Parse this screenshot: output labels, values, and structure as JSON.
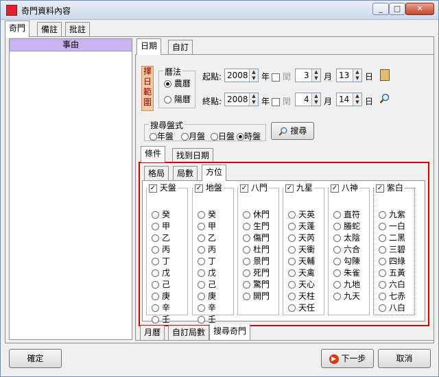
{
  "window": {
    "title": "奇門資料內容",
    "min": "_",
    "max": "□",
    "close": "✕"
  },
  "outer_tabs": [
    "奇門",
    "備註",
    "批註"
  ],
  "left_panel": {
    "header": "事由"
  },
  "date_tabs": [
    "日期",
    "自訂"
  ],
  "range": {
    "label": [
      "擇",
      "日",
      "範",
      "圍"
    ],
    "calendar_title": "曆法",
    "calendar_options": [
      "農曆",
      "陽曆"
    ],
    "start_label": "起點:",
    "end_label": "終點:",
    "start": {
      "year": "2008",
      "year_unit": "年",
      "leap": "閏",
      "month": "3",
      "month_unit": "月",
      "day": "13",
      "day_unit": "日"
    },
    "end": {
      "year": "2008",
      "year_unit": "年",
      "leap": "閏",
      "month": "4",
      "month_unit": "月",
      "day": "14",
      "day_unit": "日"
    }
  },
  "search_mode": {
    "title": "搜尋盤式",
    "options": [
      "年盤",
      "月盤",
      "日盤",
      "時盤"
    ],
    "search_button": "搜尋"
  },
  "result_tabs": [
    "條件",
    "找到日期"
  ],
  "inner_tabs": [
    "格局",
    "局數",
    "方位"
  ],
  "columns": [
    {
      "title": "天盤",
      "items": [
        "癸",
        "甲",
        "乙",
        "丙",
        "丁",
        "戊",
        "己",
        "庚",
        "辛",
        "壬"
      ]
    },
    {
      "title": "地盤",
      "items": [
        "癸",
        "甲",
        "乙",
        "丙",
        "丁",
        "戊",
        "己",
        "庚",
        "辛",
        "壬"
      ]
    },
    {
      "title": "八門",
      "items": [
        "休門",
        "生門",
        "傷門",
        "杜門",
        "景門",
        "死門",
        "驚門",
        "開門"
      ]
    },
    {
      "title": "九星",
      "items": [
        "天英",
        "天蓬",
        "天芮",
        "天衝",
        "天輔",
        "天禽",
        "天心",
        "天柱",
        "天任"
      ]
    },
    {
      "title": "八神",
      "items": [
        "直符",
        "螣蛇",
        "太陰",
        "六合",
        "勾陳",
        "朱雀",
        "九地",
        "九天"
      ]
    },
    {
      "title": "紫白",
      "items": [
        "九紫",
        "一白",
        "二黑",
        "三碧",
        "四綠",
        "五黃",
        "六白",
        "七赤",
        "八白"
      ]
    }
  ],
  "bottom_tabs": [
    "月曆",
    "自訂局數",
    "搜尋奇門"
  ],
  "footer": {
    "ok": "確定",
    "next": "下一步",
    "cancel": "取消"
  },
  "colors": {
    "accent_red": "#d00000",
    "header_purple": "#c9b3f0",
    "range_label_bg": "#f8c8a0"
  }
}
